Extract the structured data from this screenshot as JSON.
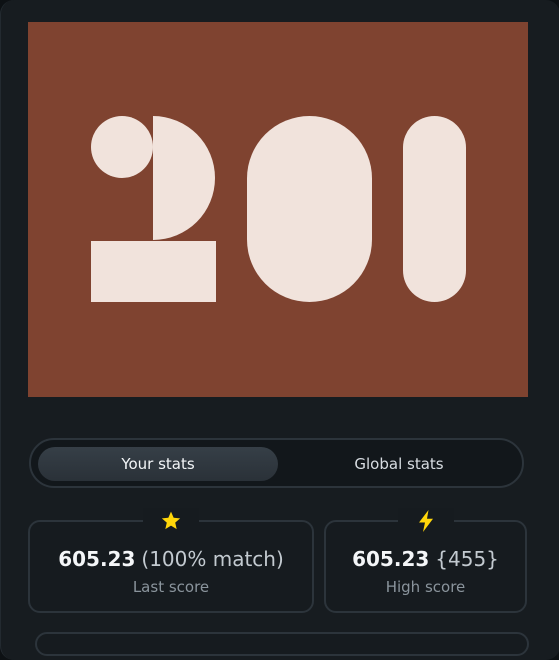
{
  "artwork": {
    "digits": "201",
    "background_color": "#7f4330",
    "shape_color": "#f1e3dc"
  },
  "stats_toggle": {
    "your_stats_label": "Your stats",
    "global_stats_label": "Global stats",
    "selected": "Your stats"
  },
  "last_score": {
    "icon": "star-icon",
    "icon_color": "#ffd60a",
    "value": "605.23",
    "extra": "(100% match)",
    "label": "Last score"
  },
  "high_score": {
    "icon": "lightning-icon",
    "icon_color": "#ffd60a",
    "value": "605.23",
    "extra": "{455}",
    "label": "High score"
  }
}
